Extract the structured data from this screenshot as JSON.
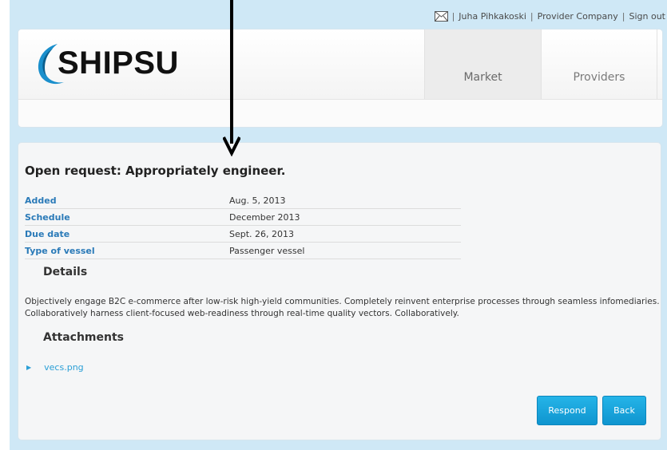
{
  "header": {
    "user_name": "Juha Pihkakoski",
    "company": "Provider Company",
    "signout": "Sign out",
    "separator": "|",
    "logo_text": "SHIPSU",
    "nav": [
      {
        "label": "Market",
        "active": true
      },
      {
        "label": "Providers",
        "active": false
      }
    ]
  },
  "request": {
    "title": "Open request: Appropriately engineer.",
    "fields": [
      {
        "label": "Added",
        "value": "Aug. 5, 2013"
      },
      {
        "label": "Schedule",
        "value": "December 2013"
      },
      {
        "label": "Due date",
        "value": "Sept. 26, 2013"
      },
      {
        "label": "Type of vessel",
        "value": "Passenger vessel"
      }
    ],
    "details_heading": "Details",
    "details_text": "Objectively engage B2C e-commerce after low-risk high-yield communities. Completely reinvent enterprise processes through seamless infomediaries. Collaboratively harness client-focused web-readiness through real-time quality vectors. Collaboratively.",
    "attachments_heading": "Attachments",
    "attachments": [
      "vecs.png"
    ]
  },
  "actions": {
    "respond_label": "Respond",
    "back_label": "Back"
  },
  "colors": {
    "accent": "#1aa6dc",
    "label_blue": "#2a7ab8",
    "background": "#cfe8f6"
  },
  "icons": {
    "mail": "mail-icon",
    "arrow": "down-arrow-icon",
    "bullet": "triangle-bullet-icon"
  }
}
